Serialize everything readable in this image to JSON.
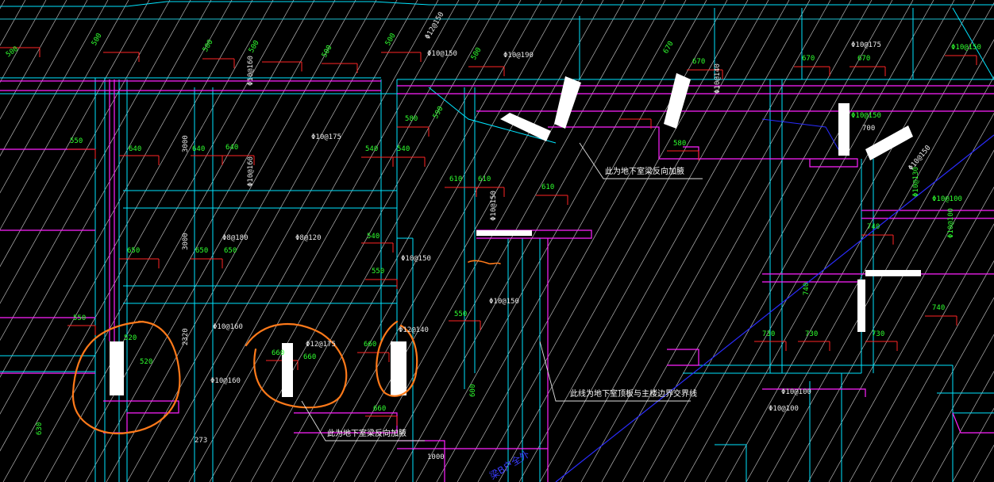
{
  "notes": {
    "reverse_beam_top": "此为地下室梁反向加腋",
    "boundary": "此线为地下室顶板与主楼边界交界线",
    "reverse_beam_bottom": "此为地下室梁反向加腋",
    "blue_partial": "梁B户全外"
  },
  "dims": {
    "d3000a": "3000",
    "d3000b": "3000",
    "d2320": "2320",
    "d273": "273",
    "d700": "700",
    "d1000": "1000"
  },
  "rebar_white": [
    "Φ10@160",
    "Φ10@150",
    "Φ10@175",
    "Φ10@160",
    "Φ8@180",
    "Φ8@120",
    "Φ10@150",
    "Φ10@150",
    "Φ10@160",
    "Φ12@175",
    "Φ10@160",
    "Φ10@100",
    "Φ10@100",
    "Φ12@140",
    "Φ10@150",
    "Φ10@140",
    "Φ10@190",
    "Φ10@175",
    "Φ10@150",
    "Φ12@150"
  ],
  "rebar_green": [
    "Φ10@150",
    "Φ10@100",
    "Φ10@130",
    "Φ10@100",
    "Φ10@150"
  ],
  "dims_green": [
    "500",
    "500",
    "500",
    "500",
    "500",
    "500",
    "500",
    "670",
    "670",
    "670",
    "670",
    "640",
    "640",
    "640",
    "550",
    "550",
    "550",
    "550",
    "650",
    "650",
    "650",
    "660",
    "660",
    "660",
    "660",
    "540",
    "540",
    "540",
    "610",
    "610",
    "610",
    "740",
    "740",
    "740",
    "730",
    "730",
    "730",
    "520",
    "520",
    "580",
    "580",
    "600",
    "630",
    "590"
  ],
  "colors": {
    "background": "#000000",
    "wall_line": "#00ffff",
    "beam_line": "#ff00ff",
    "rebar_line": "#ff2020",
    "dimension_text": "#2fff2f",
    "hatch": "#ffffff",
    "markup": "#ff7a1a",
    "boundary_line": "#2a2cff"
  }
}
